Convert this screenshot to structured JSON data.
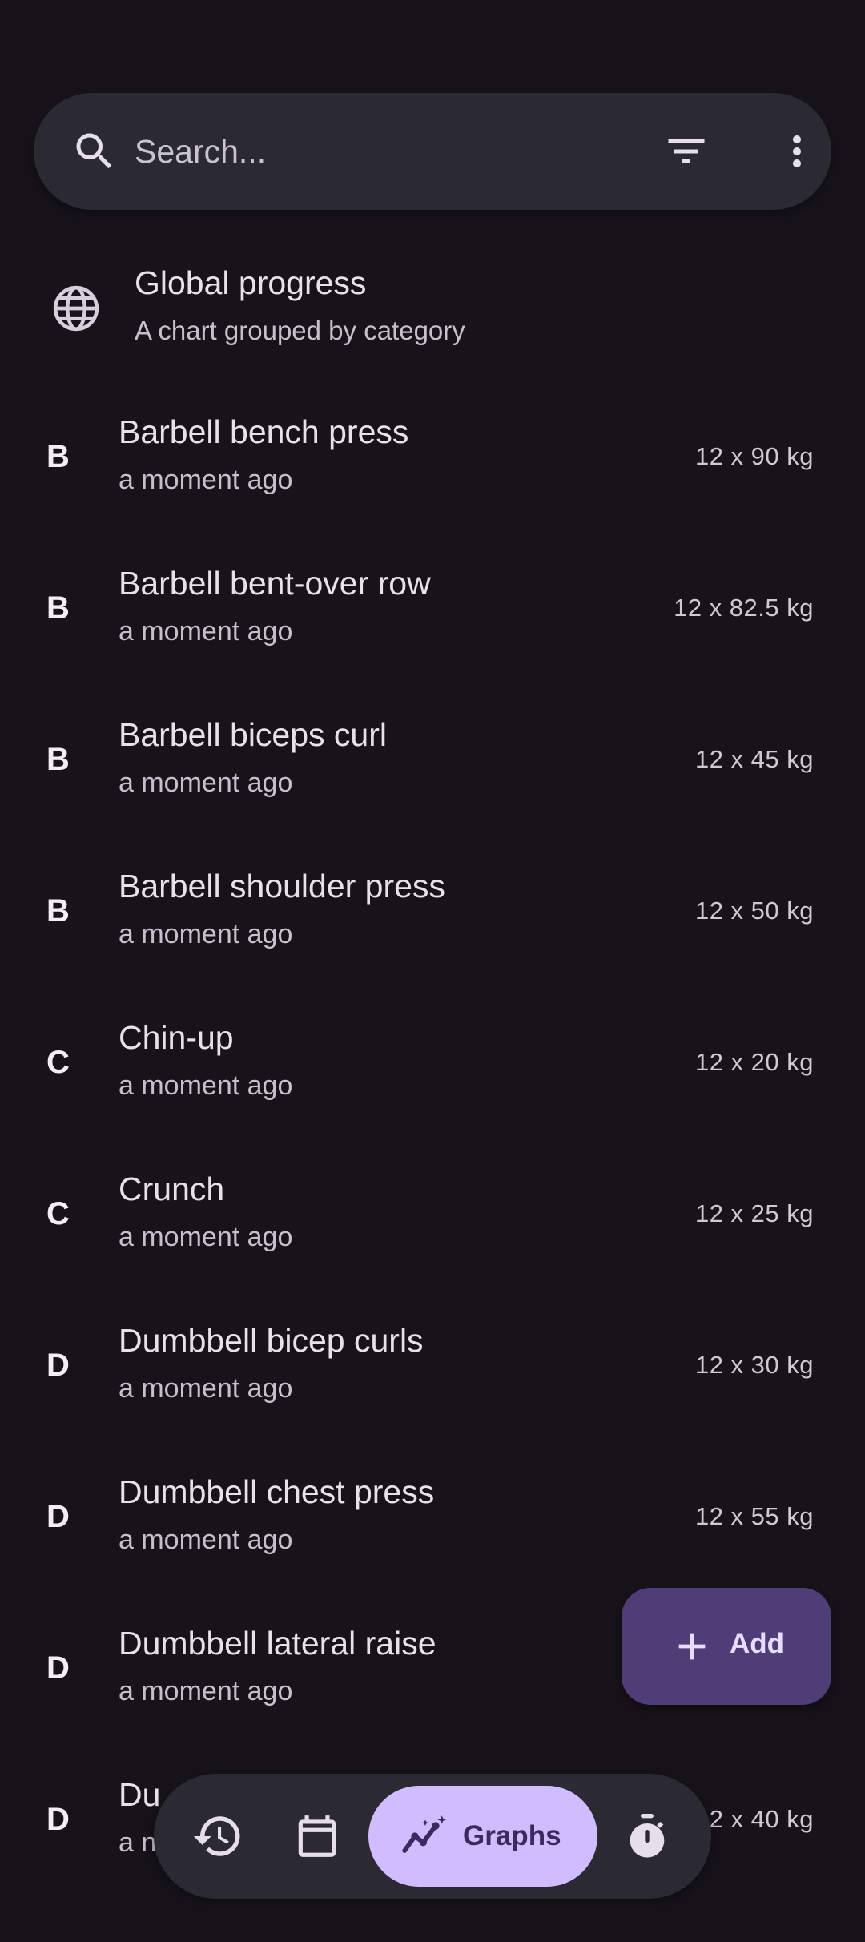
{
  "search": {
    "placeholder": "Search..."
  },
  "global_progress": {
    "title": "Global progress",
    "subtitle": "A chart grouped by category"
  },
  "exercises": [
    {
      "letter": "B",
      "name": "Barbell bench press",
      "time": "a moment ago",
      "weight": "12 x 90 kg"
    },
    {
      "letter": "B",
      "name": "Barbell bent-over row",
      "time": "a moment ago",
      "weight": "12 x 82.5 kg"
    },
    {
      "letter": "B",
      "name": "Barbell biceps curl",
      "time": "a moment ago",
      "weight": "12 x 45 kg"
    },
    {
      "letter": "B",
      "name": "Barbell shoulder press",
      "time": "a moment ago",
      "weight": "12 x 50 kg"
    },
    {
      "letter": "C",
      "name": "Chin-up",
      "time": "a moment ago",
      "weight": "12 x 20 kg"
    },
    {
      "letter": "C",
      "name": "Crunch",
      "time": "a moment ago",
      "weight": "12 x 25 kg"
    },
    {
      "letter": "D",
      "name": "Dumbbell bicep curls",
      "time": "a moment ago",
      "weight": "12 x 30 kg"
    },
    {
      "letter": "D",
      "name": "Dumbbell chest press",
      "time": "a moment ago",
      "weight": "12 x 55 kg"
    },
    {
      "letter": "D",
      "name": "Dumbbell lateral raise",
      "time": "a moment ago",
      "weight": ""
    },
    {
      "letter": "D",
      "name": "Du",
      "time": "a n",
      "weight": "2 x 40 kg"
    }
  ],
  "fab": {
    "label": "Add"
  },
  "bottom_nav": {
    "graphs_label": "Graphs",
    "items": [
      "history-icon",
      "calendar-icon",
      "graphs-icon",
      "timer-icon"
    ]
  },
  "colors": {
    "background": "#16141a",
    "surface": "#2b2931",
    "fab": "#4f3d78",
    "nav_active": "#d0bcff"
  }
}
